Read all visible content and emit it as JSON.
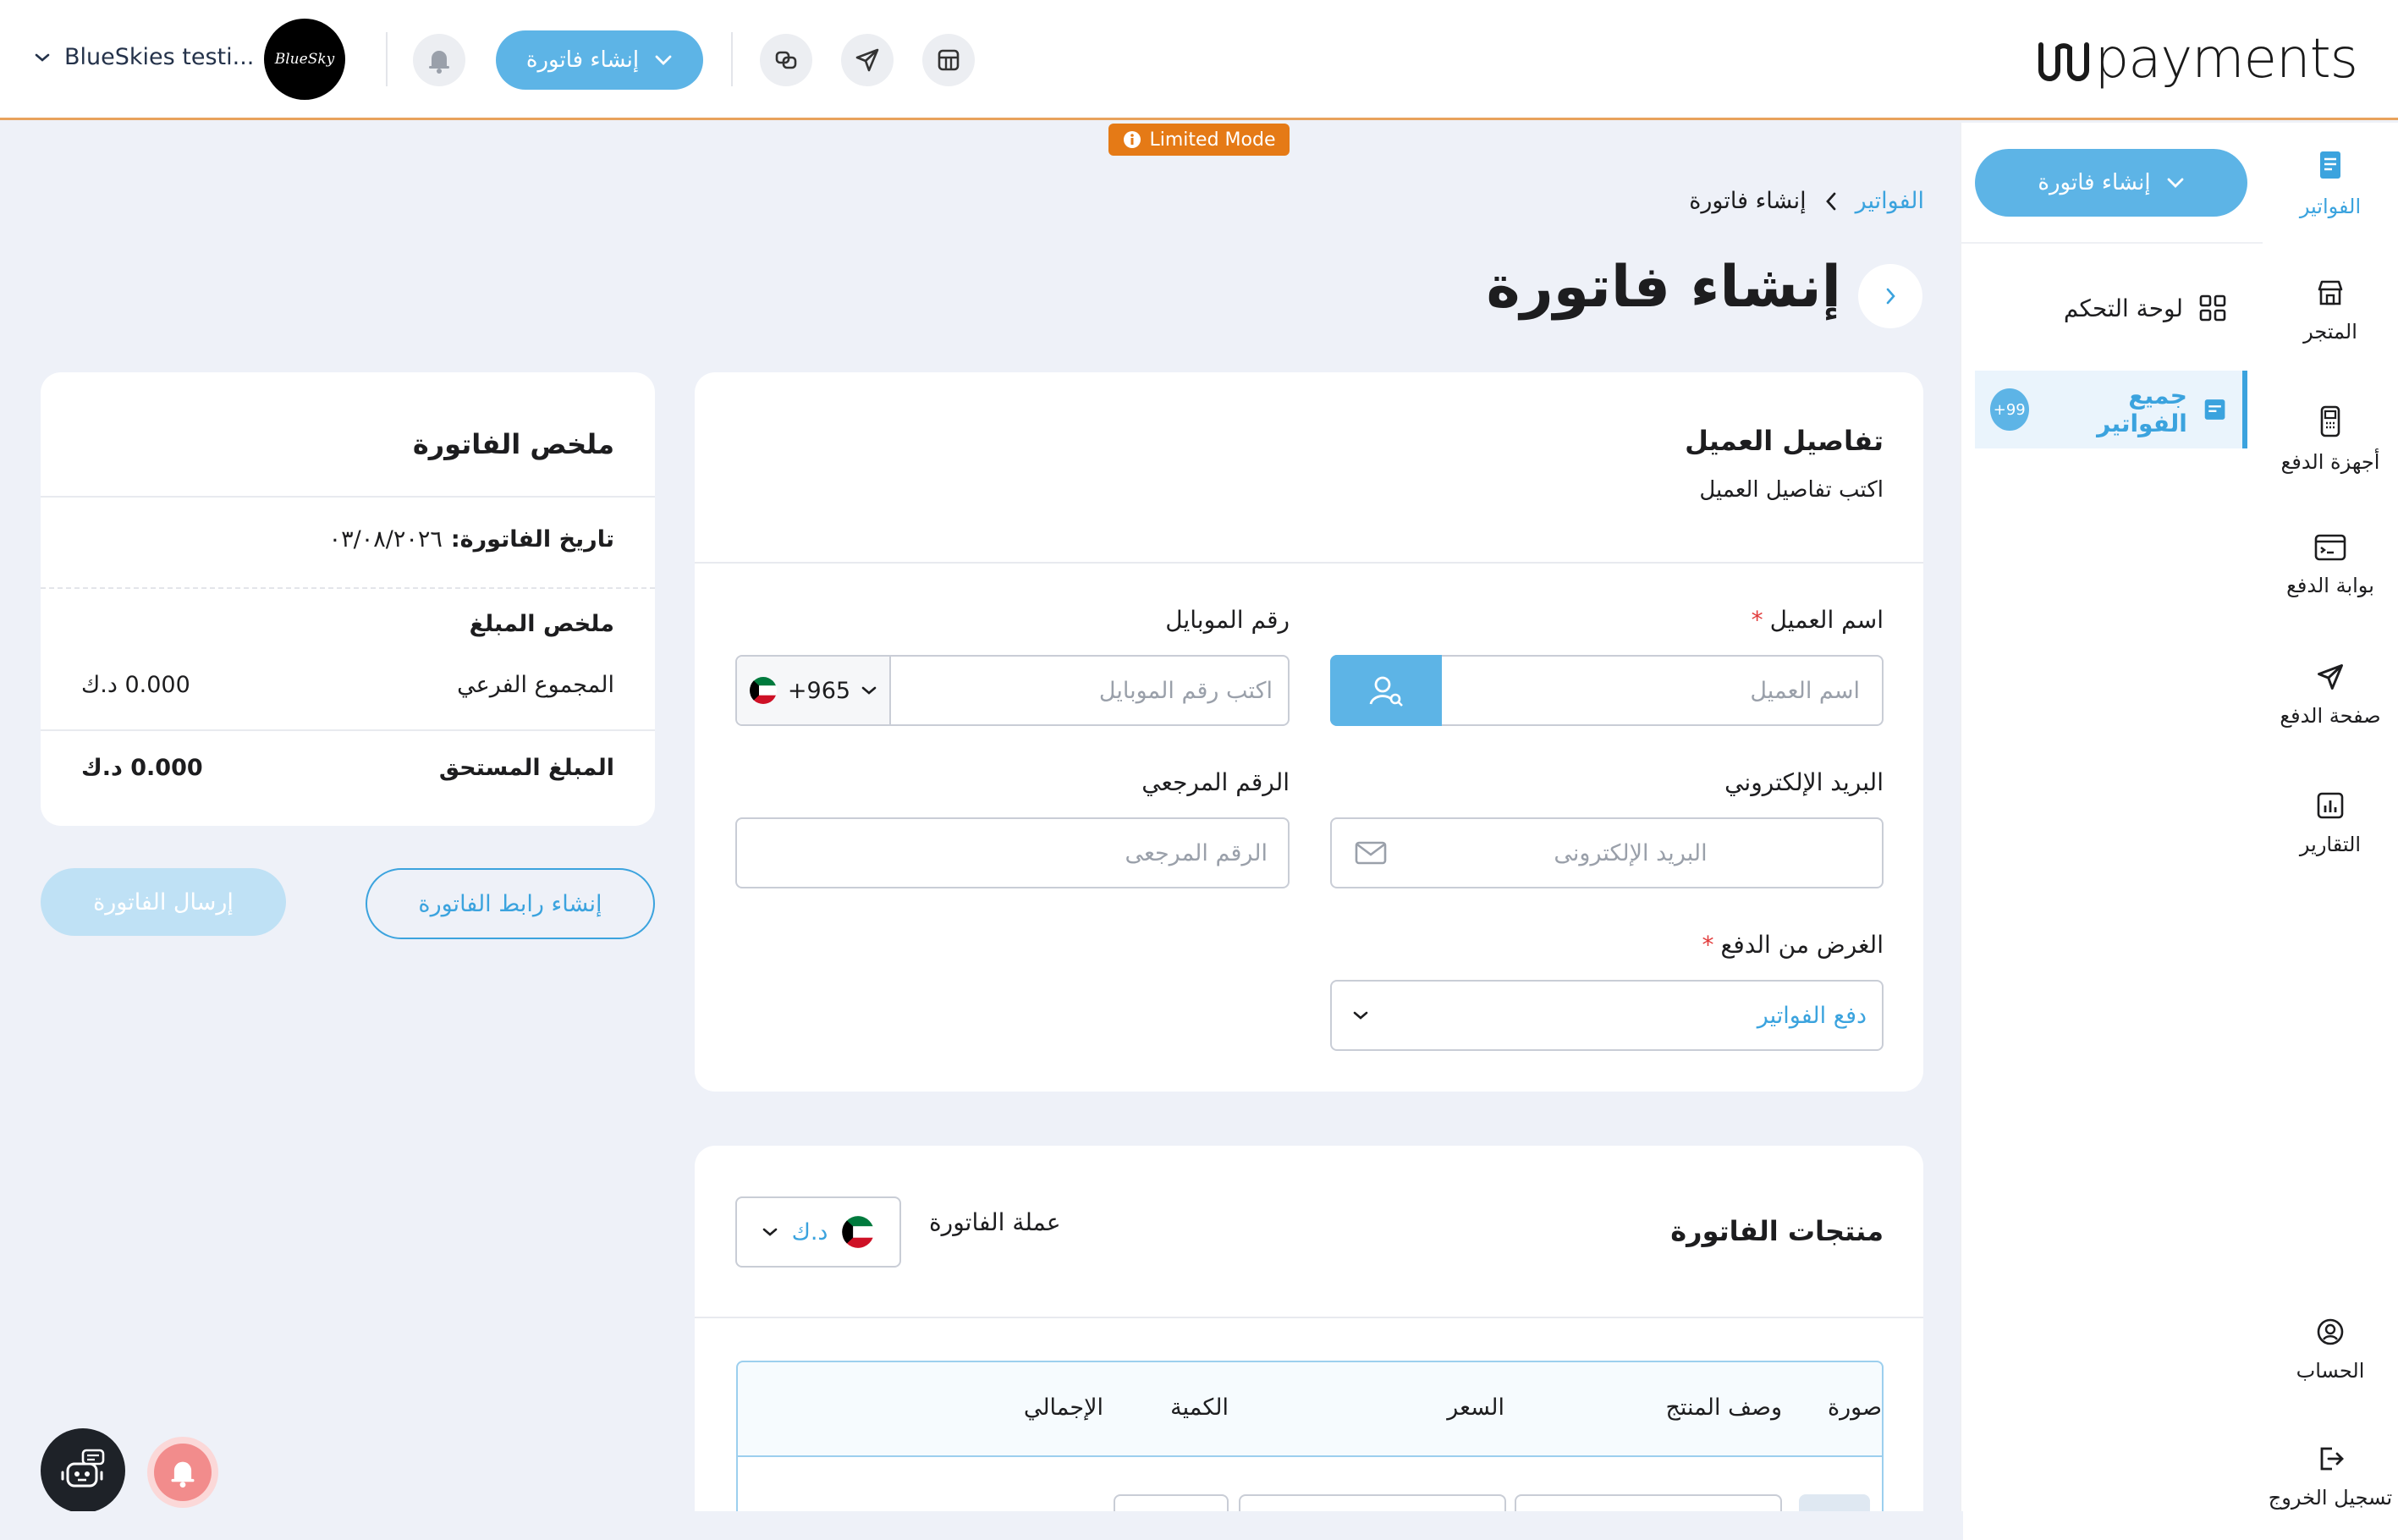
{
  "header": {
    "logo_text": "payments",
    "account_name": "BlueSkies testi...",
    "avatar_text": "BlueSky",
    "create_invoice_label": "إنشاء فاتورة"
  },
  "limited_mode": "Limited Mode",
  "rail": {
    "items": [
      {
        "label": "الفواتير",
        "icon": "invoice-icon",
        "active": true
      },
      {
        "label": "المتجر",
        "icon": "store-icon"
      },
      {
        "label": "أجهزة الدفع",
        "icon": "pos-device-icon"
      },
      {
        "label": "بوابة الدفع",
        "icon": "gateway-icon"
      },
      {
        "label": "صفحة الدفع",
        "icon": "send-icon"
      },
      {
        "label": "التقارير",
        "icon": "reports-icon"
      }
    ],
    "account_label": "الحساب",
    "logout_label": "تسجيل الخروج"
  },
  "panel": {
    "create_label": "إنشاء فاتورة",
    "dashboard_label": "لوحة التحكم",
    "all_invoices_label": "جميع الفواتير",
    "all_invoices_badge": "+99"
  },
  "breadcrumb": {
    "root": "الفواتير",
    "current": "إنشاء فاتورة"
  },
  "page_title": "إنشاء فاتورة",
  "customer": {
    "title": "تفاصيل العميل",
    "subtitle": "اكتب تفاصيل العميل",
    "name_label": "اسم العميل",
    "name_placeholder": "اسم العميل",
    "mobile_label": "رقم الموبايل",
    "mobile_placeholder": "اكتب رقم الموبايل",
    "country_code": "+965",
    "email_label": "البريد الإلكتروني",
    "email_placeholder": "البريد الإلكترونى",
    "reference_label": "الرقم المرجعي",
    "reference_placeholder": "الرقم المرجعى",
    "purpose_label": "الغرض من الدفع",
    "purpose_value": "دفع الفواتير"
  },
  "products": {
    "title": "منتجات الفاتورة",
    "currency_label": "عملة الفاتورة",
    "currency_value": "د.ك",
    "columns": [
      "صورة",
      "وصف المنتج",
      "السعر",
      "الكمية",
      "الإجمالي"
    ]
  },
  "summary": {
    "title": "ملخص الفاتورة",
    "date_label": "تاريخ الفاتورة:",
    "date_value": "٠٣/٠٨/٢٠٢٦",
    "amount_section": "ملخص المبلغ",
    "subtotal_label": "المجموع الفرعي",
    "subtotal_value": "0.000 د.ك",
    "due_label": "المبلغ المستحق",
    "due_value": "0.000 د.ك"
  },
  "actions": {
    "create_link_label": "إنشاء رابط الفاتورة",
    "send_label": "إرسال الفاتورة"
  },
  "colors": {
    "accent": "#3ba3de",
    "accent_button": "#5db4e6",
    "warning": "#e57a16",
    "background": "#eef1f8"
  }
}
